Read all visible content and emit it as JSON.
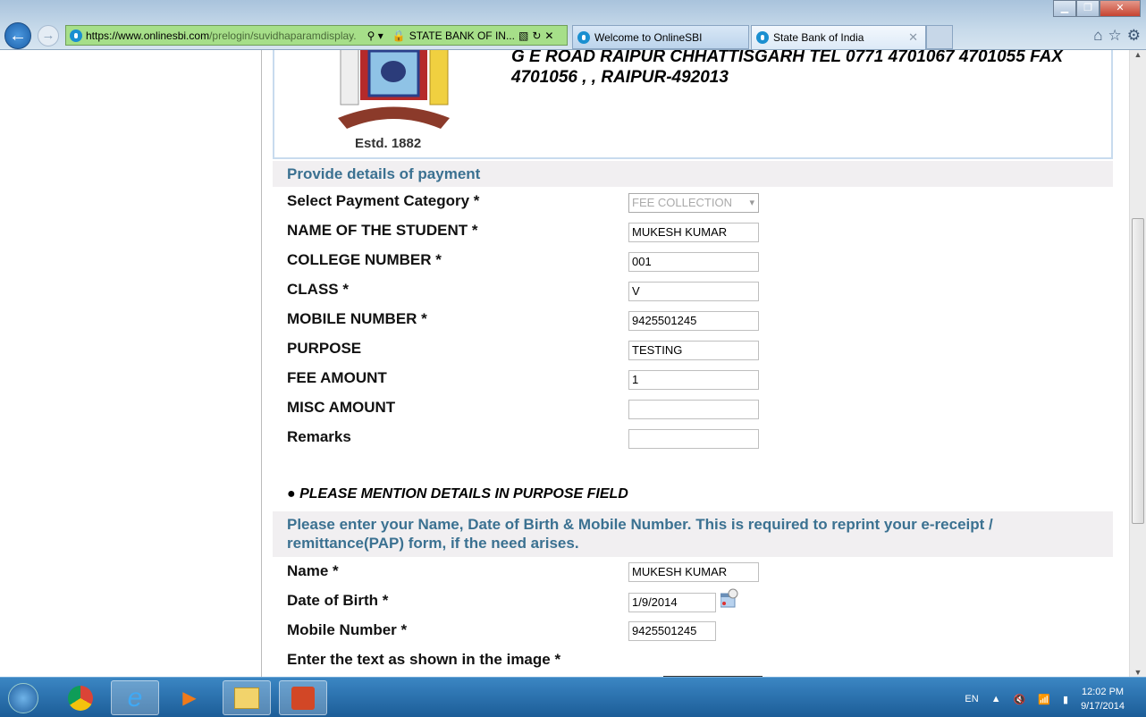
{
  "browser": {
    "url_prefix": "https://www.",
    "url_domain": "onlinesbi.com",
    "url_path": "/prelogin/suvidhaparamdisplay.",
    "site_identity": "STATE BANK OF IN...",
    "tabs": [
      {
        "label": "Welcome to OnlineSBI",
        "active": false
      },
      {
        "label": "State Bank of India",
        "active": true
      }
    ],
    "icons": [
      "back-icon",
      "forward-icon",
      "search-icon",
      "lock-icon",
      "compat-icon",
      "refresh-icon",
      "stop-icon",
      "home-icon",
      "favorites-star-icon",
      "gear-icon"
    ]
  },
  "header": {
    "address_line1": "G E ROAD RAIPUR CHHATTISGARH TEL 0771 4701067 4701055 FAX",
    "address_line2": "4701056 , , RAIPUR-492013",
    "estd": "Estd. 1882"
  },
  "payment": {
    "section_title": "Provide details of payment",
    "fields": [
      {
        "label": "Select Payment Category *",
        "value": "FEE COLLECTION",
        "type": "select"
      },
      {
        "label": "NAME OF THE STUDENT *",
        "value": "MUKESH KUMAR"
      },
      {
        "label": "COLLEGE NUMBER *",
        "value": "001"
      },
      {
        "label": "CLASS *",
        "value": "V"
      },
      {
        "label": "MOBILE NUMBER *",
        "value": "9425501245"
      },
      {
        "label": "PURPOSE",
        "value": "TESTING"
      },
      {
        "label": "FEE AMOUNT",
        "value": "1"
      },
      {
        "label": "MISC AMOUNT",
        "value": ""
      },
      {
        "label": "Remarks",
        "value": ""
      }
    ],
    "note": "PLEASE MENTION DETAILS IN PURPOSE FIELD"
  },
  "personal": {
    "section_title": "Please enter your Name, Date of Birth & Mobile Number. This is required to reprint your e-receipt / remittance(PAP) form, if the need arises.",
    "fields": [
      {
        "label": "Name *",
        "value": "MUKESH KUMAR"
      },
      {
        "label": "Date of Birth *",
        "value": "1/9/2014"
      },
      {
        "label": "Mobile Number *",
        "value": "9425501245"
      }
    ],
    "captcha_label": "Enter the text as shown in the image *"
  },
  "taskbar": {
    "apps": [
      "start-button",
      "chrome",
      "internet-explorer",
      "media-player",
      "file-explorer",
      "powerpoint"
    ],
    "language": "EN",
    "time": "12:02 PM",
    "date": "9/17/2014"
  }
}
